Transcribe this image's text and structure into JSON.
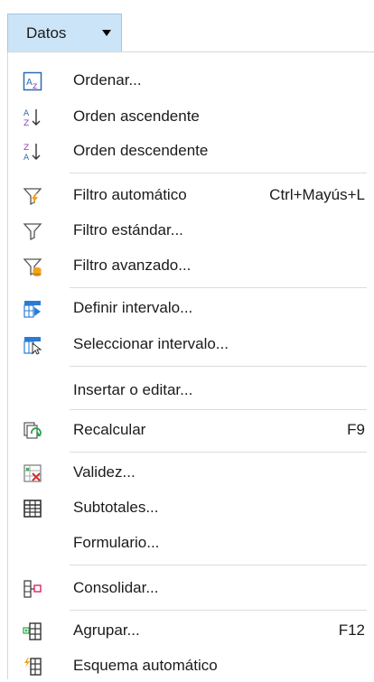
{
  "menu": {
    "title": "Datos"
  },
  "items": [
    {
      "label": "Ordenar...",
      "icon": "sort-icon",
      "shortcut": ""
    },
    {
      "label": "Orden ascendente",
      "icon": "sort-ascending-icon",
      "shortcut": ""
    },
    {
      "label": "Orden descendente",
      "icon": "sort-descending-icon",
      "shortcut": ""
    },
    {
      "label": "Filtro automático",
      "icon": "autofilter-icon",
      "shortcut": "Ctrl+Mayús+L"
    },
    {
      "label": "Filtro estándar...",
      "icon": "standard-filter-icon",
      "shortcut": ""
    },
    {
      "label": "Filtro avanzado...",
      "icon": "advanced-filter-icon",
      "shortcut": ""
    },
    {
      "label": "Definir intervalo...",
      "icon": "define-range-icon",
      "shortcut": ""
    },
    {
      "label": "Seleccionar intervalo...",
      "icon": "select-range-icon",
      "shortcut": ""
    },
    {
      "label": "Insertar o editar...",
      "icon": "",
      "shortcut": ""
    },
    {
      "label": "Recalcular",
      "icon": "recalculate-icon",
      "shortcut": "F9"
    },
    {
      "label": "Validez...",
      "icon": "validity-icon",
      "shortcut": ""
    },
    {
      "label": "Subtotales...",
      "icon": "subtotals-icon",
      "shortcut": ""
    },
    {
      "label": "Formulario...",
      "icon": "",
      "shortcut": ""
    },
    {
      "label": "Consolidar...",
      "icon": "consolidate-icon",
      "shortcut": ""
    },
    {
      "label": "Agrupar...",
      "icon": "group-icon",
      "shortcut": "F12"
    },
    {
      "label": "Esquema automático",
      "icon": "auto-outline-icon",
      "shortcut": ""
    }
  ]
}
